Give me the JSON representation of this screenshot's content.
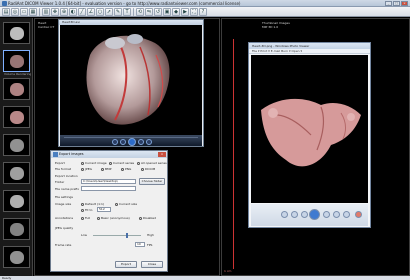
{
  "window": {
    "title": "RadiAnt DICOM Viewer 1.0.4 [64-bit] - evaluation version - go to http://www.radiantviewer.com (commercial license)"
  },
  "toolbar": {
    "icons": [
      "open-icon",
      "cd-icon",
      "folder-icon",
      "database-icon",
      "layout-icon",
      "pan-icon",
      "zoom-icon",
      "window-level-icon",
      "length-icon",
      "angle-icon",
      "ellipse-icon",
      "arrow-icon",
      "pencil-icon",
      "text-icon",
      "rotate-icon",
      "flip-icon",
      "reset-icon",
      "mpr-icon",
      "3d-icon",
      "cine-icon",
      "fullscreen-icon",
      "help-icon"
    ]
  },
  "thumbs": {
    "items": [
      {
        "label": ""
      },
      {
        "label": "Volume Rendering"
      },
      {
        "label": ""
      },
      {
        "label": ""
      },
      {
        "label": ""
      },
      {
        "label": ""
      },
      {
        "label": ""
      },
      {
        "label": ""
      },
      {
        "label": ""
      }
    ]
  },
  "viewers": {
    "left": {
      "line1": "Heart",
      "line2": "Cardiac CT"
    },
    "right": {
      "line1": "Thumbnail Images",
      "line2": "MIP 3D 1.0",
      "scale": "1 cm"
    }
  },
  "player": {
    "title": "Heart3D.avi"
  },
  "photo": {
    "title": "Heart-3D.png - Windows Photo Viewer",
    "menu": "File ▾   Print ▾   E-mail   Burn ▾   Open ▾"
  },
  "dialog": {
    "title": "Export images",
    "export_label": "Export",
    "export_opts": [
      "Current image",
      "Current series",
      "All opened series"
    ],
    "filetype_label": "File format",
    "filetype_opts": [
      "JPEG",
      "BMP",
      "PNG",
      "DICOM"
    ],
    "location_label": "Export location",
    "folder_label": "Folder",
    "folder_value": "C:\\Users\\User\\Desktop\\",
    "browse_label": "Choose folder",
    "prefix_label": "File name prefix",
    "settings_label": "File settings",
    "size_label": "Image size",
    "size_opts": [
      "Default (1:1)",
      "Current size"
    ],
    "fit_label": "Fit to",
    "fit_value": "512",
    "annot_label": "Annotations",
    "annot_opts": [
      "Full",
      "Basic (anonymous)",
      "Disabled"
    ],
    "jpeg_label": "JPEG quality",
    "quality_label": "Low",
    "quality_high": "High",
    "quality_value": 0.72,
    "frame_label": "Frame rate",
    "frame_value": "10",
    "frame_unit": "FPS",
    "export_button": "Export",
    "close_button": "Close"
  },
  "status": {
    "text": "Ready"
  }
}
